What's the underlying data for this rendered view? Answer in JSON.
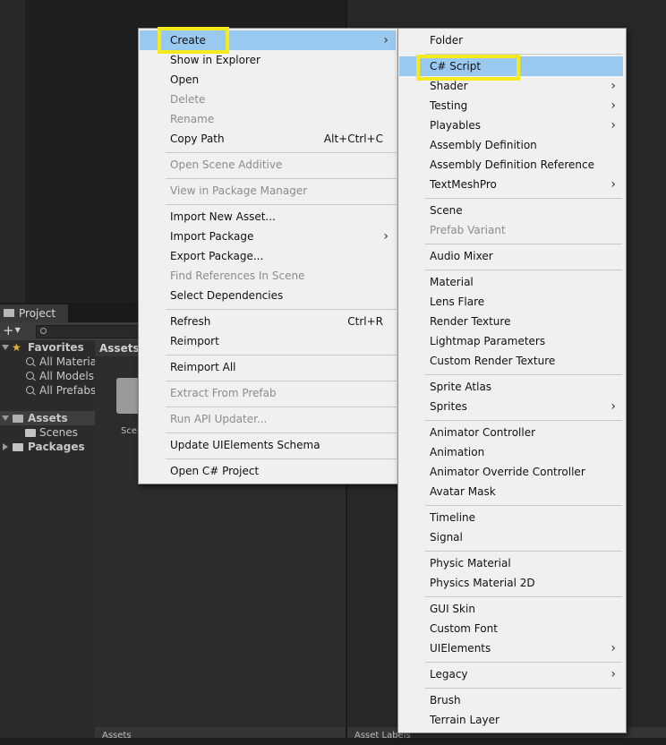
{
  "project_panel": {
    "tab_label": "Project",
    "add_symbol": "+",
    "favorites": {
      "label": "Favorites",
      "items": [
        "All Materia",
        "All Models",
        "All Prefabs"
      ]
    },
    "assets_label": "Assets",
    "scenes_label": "Scenes",
    "packages_label": "Packages",
    "assets_header": "Assets",
    "folder_label": "Scer",
    "bottom_left_text": "Assets",
    "bottom_right_text": "Asset Labels"
  },
  "main_menu": {
    "items": [
      {
        "label": "Create",
        "highlighted": true,
        "submenu": true
      },
      {
        "label": "Show in Explorer"
      },
      {
        "label": "Open"
      },
      {
        "label": "Delete",
        "disabled": true
      },
      {
        "label": "Rename",
        "disabled": true
      },
      {
        "label": "Copy Path",
        "shortcut": "Alt+Ctrl+C"
      },
      {
        "label": "Open Scene Additive",
        "disabled": true
      },
      {
        "label": "View in Package Manager",
        "disabled": true
      },
      {
        "label": "Import New Asset..."
      },
      {
        "label": "Import Package",
        "submenu": true
      },
      {
        "label": "Export Package..."
      },
      {
        "label": "Find References In Scene",
        "disabled": true
      },
      {
        "label": "Select Dependencies"
      },
      {
        "label": "Refresh",
        "shortcut": "Ctrl+R"
      },
      {
        "label": "Reimport"
      },
      {
        "label": "Reimport All"
      },
      {
        "label": "Extract From Prefab",
        "disabled": true
      },
      {
        "label": "Run API Updater...",
        "disabled": true
      },
      {
        "label": "Update UIElements Schema"
      },
      {
        "label": "Open C# Project"
      }
    ]
  },
  "create_submenu": {
    "items": [
      {
        "label": "Folder"
      },
      {
        "label": "C# Script",
        "highlighted": true
      },
      {
        "label": "Shader",
        "submenu": true
      },
      {
        "label": "Testing",
        "submenu": true
      },
      {
        "label": "Playables",
        "submenu": true
      },
      {
        "label": "Assembly Definition"
      },
      {
        "label": "Assembly Definition Reference"
      },
      {
        "label": "TextMeshPro",
        "submenu": true
      },
      {
        "label": "Scene"
      },
      {
        "label": "Prefab Variant",
        "disabled": true
      },
      {
        "label": "Audio Mixer"
      },
      {
        "label": "Material"
      },
      {
        "label": "Lens Flare"
      },
      {
        "label": "Render Texture"
      },
      {
        "label": "Lightmap Parameters"
      },
      {
        "label": "Custom Render Texture"
      },
      {
        "label": "Sprite Atlas"
      },
      {
        "label": "Sprites",
        "submenu": true
      },
      {
        "label": "Animator Controller"
      },
      {
        "label": "Animation"
      },
      {
        "label": "Animator Override Controller"
      },
      {
        "label": "Avatar Mask"
      },
      {
        "label": "Timeline"
      },
      {
        "label": "Signal"
      },
      {
        "label": "Physic Material"
      },
      {
        "label": "Physics Material 2D"
      },
      {
        "label": "GUI Skin"
      },
      {
        "label": "Custom Font"
      },
      {
        "label": "UIElements",
        "submenu": true
      },
      {
        "label": "Legacy",
        "submenu": true
      },
      {
        "label": "Brush"
      },
      {
        "label": "Terrain Layer"
      }
    ]
  },
  "colors": {
    "menu_background": "#f0f0f0",
    "menu_highlight": "#99c9ef",
    "annotation_box": "#f5ea1d",
    "disabled_text": "#8c8c8c"
  },
  "icons": {
    "submenu_arrow": "chevron-right-icon",
    "favorites": "star-icon",
    "search": "magnifier-icon",
    "folder": "folder-icon"
  }
}
